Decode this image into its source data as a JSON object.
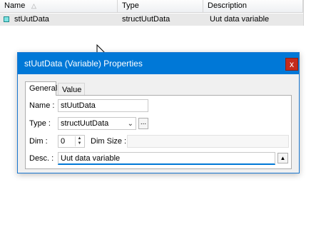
{
  "list": {
    "columns": [
      {
        "label": "Name"
      },
      {
        "label": "Type"
      },
      {
        "label": "Description"
      }
    ],
    "rows": [
      {
        "name": "stUutData",
        "type": "structUutData",
        "description": "Uut data variable"
      }
    ]
  },
  "dialog": {
    "title": "stUutData (Variable) Properties",
    "close_label": "x",
    "tabs": [
      {
        "label": "General",
        "active": true
      },
      {
        "label": "Value",
        "active": false
      }
    ],
    "general": {
      "name_label": "Name :",
      "name_value": "stUutData",
      "type_label": "Type :",
      "type_value": "structUutData",
      "browse_label": "...",
      "dim_label": "Dim :",
      "dim_value": "0",
      "dim_size_label": "Dim Size :",
      "desc_label": "Desc. :",
      "desc_value": "Uut data variable"
    }
  },
  "icons": {
    "sort": "sort-up-icon",
    "row": "variable-icon",
    "combo": "chevron-down-icon",
    "spin_up": "spin-up-icon",
    "spin_down": "spin-down-icon",
    "expand": "triangle-up-icon",
    "close": "close-icon",
    "cursor": "mouse-cursor-icon"
  },
  "colors": {
    "titlebar": "#0078d7",
    "close_button": "#c42b1c",
    "selected_row": "#e8e8e8",
    "focus_underline": "#0078d7"
  }
}
